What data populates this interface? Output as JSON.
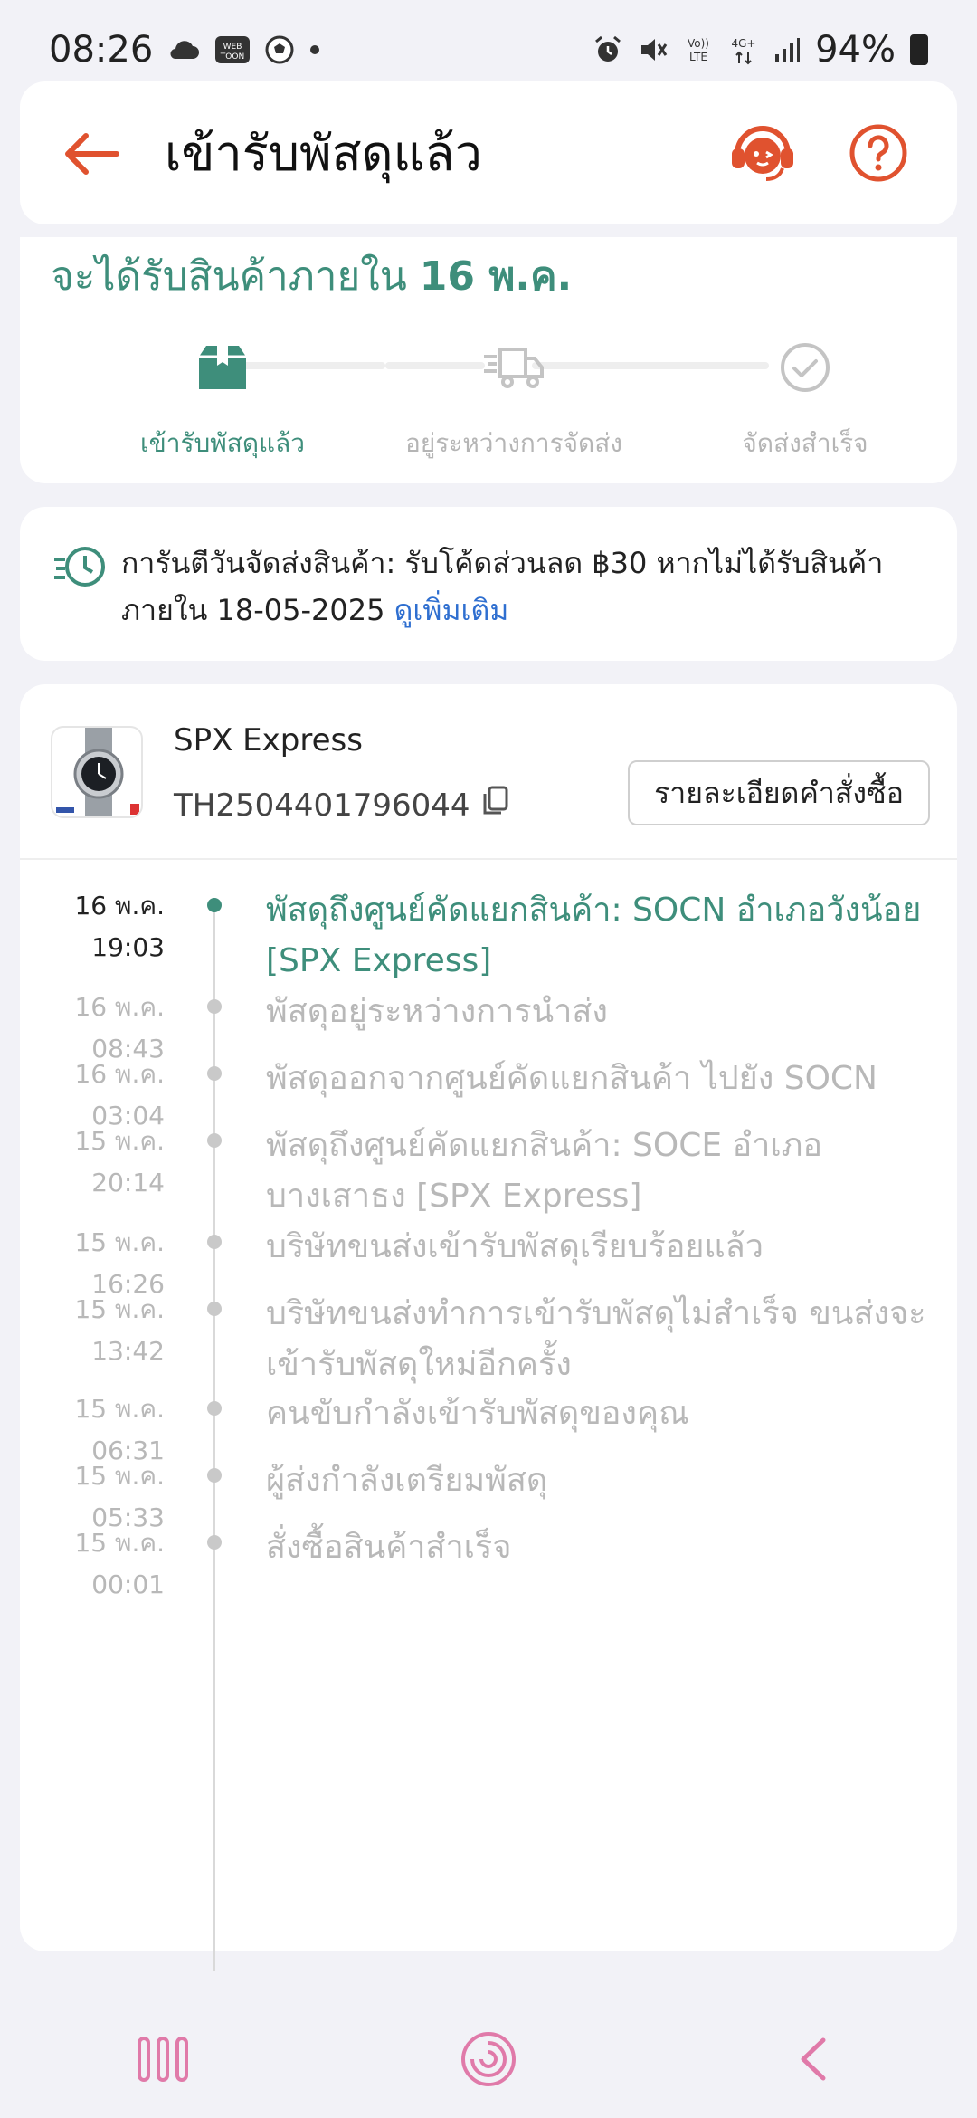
{
  "status_bar": {
    "time": "08:26",
    "app_badge": "WEB TOON",
    "battery_percent": "94%"
  },
  "header": {
    "title": "เข้ารับพัสดุแล้ว"
  },
  "progress": {
    "eta_prefix": "จะได้รับสินค้าภายใน ",
    "eta_date": "16 พ.ค.",
    "steps": [
      {
        "label": "เข้ารับพัสดุแล้ว",
        "icon": "box-icon",
        "active": true
      },
      {
        "label": "อยู่ระหว่างการจัดส่ง",
        "icon": "truck-icon",
        "active": false
      },
      {
        "label": "จัดส่งสำเร็จ",
        "icon": "check-circle-icon",
        "active": false
      }
    ]
  },
  "guarantee": {
    "text": "การันตีวันจัดส่งสินค้า: รับโค้ดส่วนลด ฿30 หากไม่ได้รับสินค้าภายใน 18-05-2025 ",
    "link": "ดูเพิ่มเติม"
  },
  "shipment": {
    "carrier": "SPX Express",
    "tracking_number": "TH2504401796044",
    "order_details_label": "รายละเอียดคำสั่งซื้อ"
  },
  "events": [
    {
      "date": "16 พ.ค.",
      "time": "19:03",
      "desc": "พัสดุถึงศูนย์คัดแยกสินค้า: SOCN อำเภอวังน้อย [SPX Express]",
      "current": true
    },
    {
      "date": "16 พ.ค.",
      "time": "08:43",
      "desc": "พัสดุอยู่ระหว่างการนำส่ง",
      "current": false
    },
    {
      "date": "16 พ.ค.",
      "time": "03:04",
      "desc": "พัสดุออกจากศูนย์คัดแยกสินค้า ไปยัง SOCN",
      "current": false
    },
    {
      "date": "15 พ.ค.",
      "time": "20:14",
      "desc": "พัสดุถึงศูนย์คัดแยกสินค้า: SOCE อำเภอบางเสาธง [SPX Express]",
      "current": false
    },
    {
      "date": "15 พ.ค.",
      "time": "16:26",
      "desc": "บริษัทขนส่งเข้ารับพัสดุเรียบร้อยแล้ว",
      "current": false
    },
    {
      "date": "15 พ.ค.",
      "time": "13:42",
      "desc": "บริษัทขนส่งทำการเข้ารับพัสดุไม่สำเร็จ ขนส่งจะเข้ารับพัสดุใหม่อีกครั้ง",
      "current": false
    },
    {
      "date": "15 พ.ค.",
      "time": "06:31",
      "desc": "คนขับกำลังเข้ารับพัสดุของคุณ",
      "current": false
    },
    {
      "date": "15 พ.ค.",
      "time": "05:33",
      "desc": " ผู้ส่งกำลังเตรียมพัสดุ",
      "current": false
    },
    {
      "date": "15 พ.ค.",
      "time": "00:01",
      "desc": "สั่งซื้อสินค้าสำเร็จ",
      "current": false
    }
  ],
  "colors": {
    "accent_green": "#3e8e7b",
    "accent_orange": "#e0522f",
    "link_blue": "#2f6fd0",
    "nav_pink": "#e07aa9"
  }
}
